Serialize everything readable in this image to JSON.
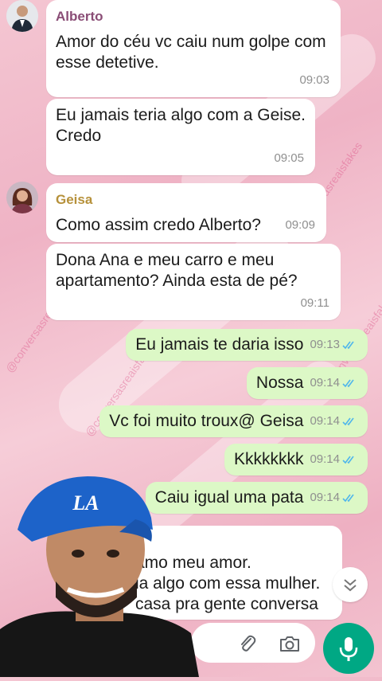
{
  "watermark": "@conversasreaisfakes",
  "messages": [
    {
      "sender": "Alberto",
      "text": [
        "Amor do céu vc caiu num golpe com",
        "esse detetive."
      ],
      "time": "09:03"
    },
    {
      "text": [
        "Eu jamais teria algo com a Geise.",
        "Credo"
      ],
      "time": "09:05"
    },
    {
      "sender": "Geisa",
      "text": [
        "Como assim credo Alberto?"
      ],
      "time": "09:09"
    },
    {
      "text": [
        "Dona Ana e meu carro e meu",
        "apartamento? Ainda esta de pé?"
      ],
      "time": "09:11"
    }
  ],
  "outgoing": [
    {
      "text": "Eu jamais te daria isso",
      "time": "09:13"
    },
    {
      "text": "Nossa",
      "time": "09:14"
    },
    {
      "text": "Vc foi muito troux@ Geisa",
      "time": "09:14"
    },
    {
      "text": "Kkkkkkkk",
      "time": "09:14"
    },
    {
      "text": "Caiu igual uma pata",
      "time": "09:14"
    }
  ],
  "partial_message": [
    "amo meu amor.",
    "ia algo com essa mulher.",
    "casa pra gente conversa"
  ],
  "cap_text": "LA",
  "colors": {
    "outgoing_bubble": "#dcf8c6",
    "mic": "#00a884",
    "tick": "#4fb6ec",
    "alberto_name": "#8a4d76",
    "geisa_name": "#b6913b"
  },
  "icons": [
    "attach-icon",
    "camera-icon",
    "mic-icon",
    "chevron-down-icon",
    "double-check-icon"
  ]
}
